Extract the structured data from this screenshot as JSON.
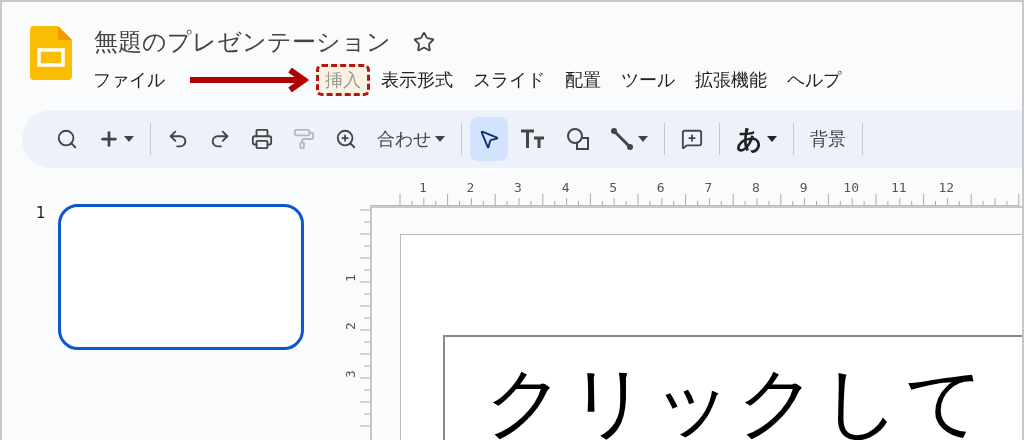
{
  "document": {
    "title": "無題のプレゼンテーション",
    "starred": false
  },
  "menu": [
    {
      "label": "ファイル",
      "highlighted": false
    },
    {
      "kind": "arrow"
    },
    {
      "label": "挿入",
      "highlighted": true
    },
    {
      "label": "表示形式",
      "highlighted": false
    },
    {
      "label": "スライド",
      "highlighted": false
    },
    {
      "label": "配置",
      "highlighted": false
    },
    {
      "label": "ツール",
      "highlighted": false
    },
    {
      "label": "拡張機能",
      "highlighted": false
    },
    {
      "label": "ヘルプ",
      "highlighted": false
    }
  ],
  "toolbar": [
    {
      "kind": "search",
      "selected": false,
      "disabled": false,
      "dropdown": false
    },
    {
      "kind": "add",
      "selected": false,
      "disabled": false,
      "dropdown": true
    },
    {
      "kind": "divider"
    },
    {
      "kind": "undo",
      "selected": false,
      "disabled": false,
      "dropdown": false
    },
    {
      "kind": "redo",
      "selected": false,
      "disabled": false,
      "dropdown": false
    },
    {
      "kind": "print",
      "selected": false,
      "disabled": false,
      "dropdown": false
    },
    {
      "kind": "paint",
      "selected": false,
      "disabled": true,
      "dropdown": false
    },
    {
      "kind": "zoom",
      "selected": false,
      "disabled": false,
      "dropdown": false
    },
    {
      "kind": "text",
      "label": "合わせ",
      "selected": false,
      "disabled": false,
      "dropdown": true
    },
    {
      "kind": "divider"
    },
    {
      "kind": "select",
      "selected": true,
      "disabled": false,
      "dropdown": false
    },
    {
      "kind": "textbox",
      "selected": false,
      "disabled": false,
      "dropdown": false
    },
    {
      "kind": "shape",
      "selected": false,
      "disabled": false,
      "dropdown": false
    },
    {
      "kind": "line",
      "selected": false,
      "disabled": false,
      "dropdown": true
    },
    {
      "kind": "divider"
    },
    {
      "kind": "comment",
      "selected": false,
      "disabled": false,
      "dropdown": false
    },
    {
      "kind": "divider"
    },
    {
      "kind": "glyph",
      "label": "あ",
      "selected": false,
      "disabled": false,
      "dropdown": true
    },
    {
      "kind": "divider"
    },
    {
      "kind": "text",
      "label": "背景",
      "selected": false,
      "disabled": false,
      "dropdown": false
    },
    {
      "kind": "divider"
    }
  ],
  "slides": [
    {
      "number": "1",
      "selected": true
    }
  ],
  "ruler": {
    "horizontal": [
      "1",
      "2",
      "3",
      "4",
      "5",
      "6",
      "7",
      "8",
      "9",
      "10",
      "11",
      "12"
    ],
    "vertical": [
      "1",
      "2",
      "3"
    ]
  },
  "slide": {
    "title_placeholder": "クリックして"
  }
}
